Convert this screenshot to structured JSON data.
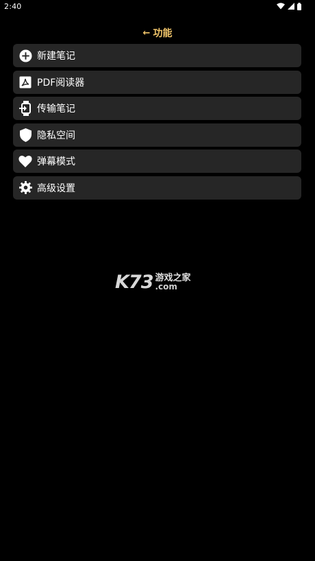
{
  "status_bar": {
    "time": "2:40",
    "icons": [
      "wifi-icon",
      "signal-icon",
      "battery-icon"
    ]
  },
  "header": {
    "back_icon": "←",
    "title": "功能",
    "accent_color": "#f2c66b"
  },
  "menu": {
    "items": [
      {
        "label": "新建笔记",
        "icon": "add-circle-icon"
      },
      {
        "label": "PDF阅读器",
        "icon": "pdf-icon"
      },
      {
        "label": "传输笔记",
        "icon": "transfer-icon"
      },
      {
        "label": "隐私空间",
        "icon": "shield-icon"
      },
      {
        "label": "弹幕模式",
        "icon": "heart-icon"
      },
      {
        "label": "高级设置",
        "icon": "gear-icon"
      }
    ]
  },
  "watermark": {
    "brand": "K73",
    "site_name": "游戏之家",
    "domain": ".com"
  }
}
